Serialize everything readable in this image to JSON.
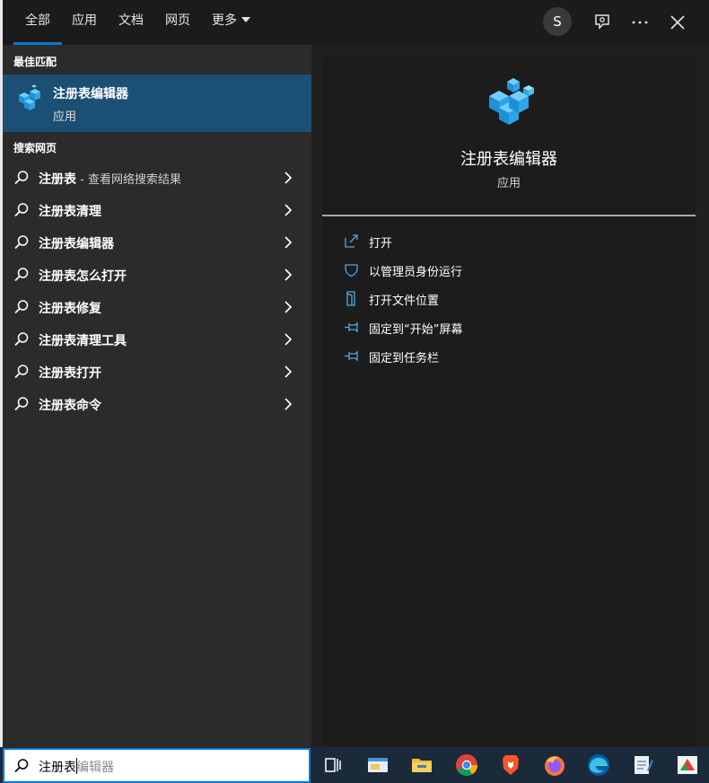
{
  "header": {
    "tabs": [
      {
        "label": "全部",
        "active": true
      },
      {
        "label": "应用",
        "active": false
      },
      {
        "label": "文档",
        "active": false
      },
      {
        "label": "网页",
        "active": false
      },
      {
        "label": "更多",
        "active": false,
        "has_dropdown": true
      }
    ],
    "avatar_letter": "S",
    "icons": [
      "feedback-icon",
      "more-options-icon",
      "close-icon"
    ]
  },
  "best_match": {
    "section_title": "最佳匹配",
    "title": "注册表编辑器",
    "subtitle": "应用",
    "icon": "registry-editor-icon"
  },
  "web": {
    "section_title": "搜索网页",
    "items": [
      {
        "label": "注册表",
        "hint": " - 查看网络搜索结果"
      },
      {
        "label": "注册表清理",
        "hint": ""
      },
      {
        "label": "注册表编辑器",
        "hint": ""
      },
      {
        "label": "注册表怎么打开",
        "hint": ""
      },
      {
        "label": "注册表修复",
        "hint": ""
      },
      {
        "label": "注册表清理工具",
        "hint": ""
      },
      {
        "label": "注册表打开",
        "hint": ""
      },
      {
        "label": "注册表命令",
        "hint": ""
      }
    ]
  },
  "detail": {
    "app_name": "注册表编辑器",
    "app_type": "应用",
    "actions": [
      {
        "label": "打开",
        "icon": "open-icon"
      },
      {
        "label": "以管理员身份运行",
        "icon": "shield-icon"
      },
      {
        "label": "打开文件位置",
        "icon": "file-location-icon"
      },
      {
        "label": "固定到“开始”屏幕",
        "icon": "pin-icon"
      },
      {
        "label": "固定到任务栏",
        "icon": "pin-icon"
      }
    ]
  },
  "search": {
    "typed": "注册表",
    "suggestion": "编辑器"
  },
  "taskbar": {
    "apps": [
      "task-view-icon",
      "mail-icon",
      "file-explorer-icon",
      "chrome-icon",
      "brave-icon",
      "firefox-icon",
      "edge-icon",
      "notepad-icon",
      "app-icon"
    ]
  },
  "colors": {
    "accent": "#0b78d7",
    "selected_row": "#1b4f73",
    "panel_bg": "#202020",
    "left_bg": "#2b2b2b",
    "right_bg": "#1c1c1c"
  }
}
